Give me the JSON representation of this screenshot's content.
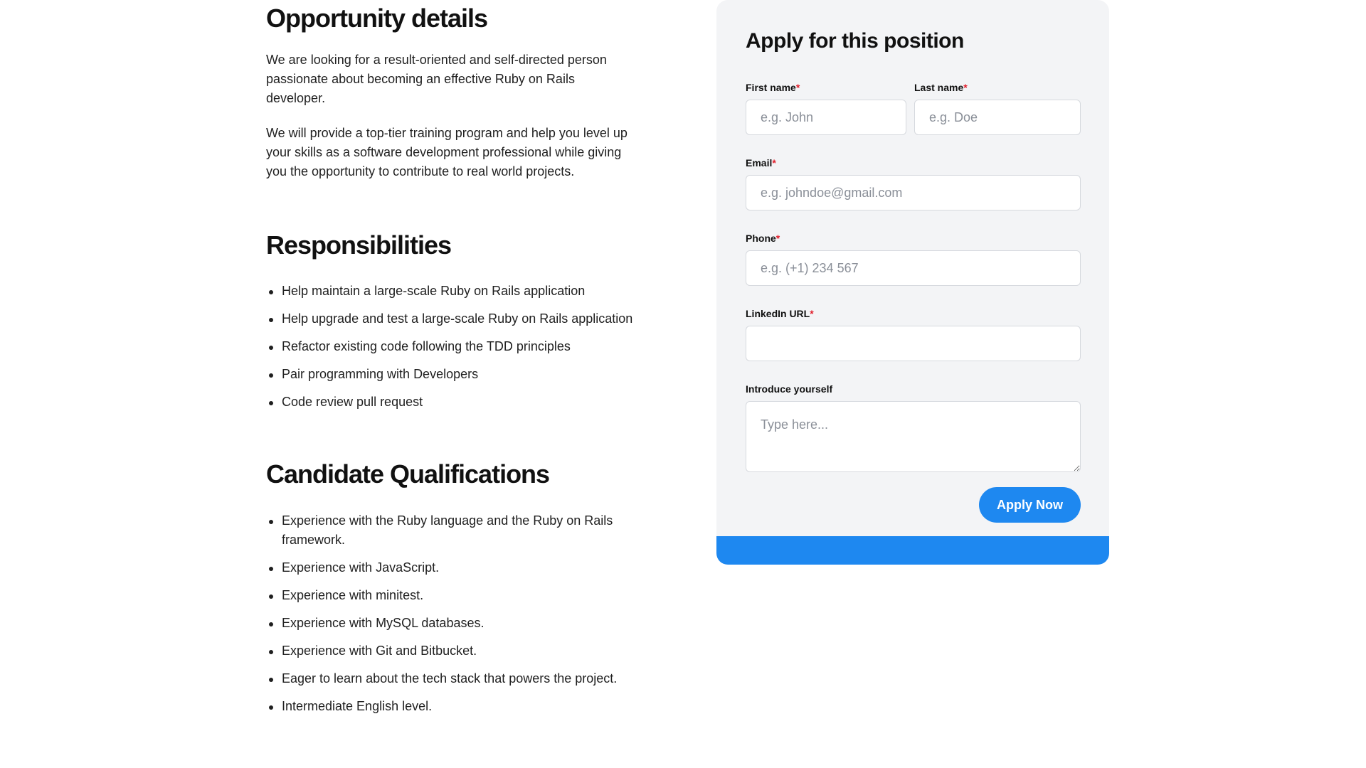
{
  "opportunity": {
    "title": "Opportunity details",
    "paragraphs": [
      "We are looking for a result-oriented and self-directed person passionate about becoming an effective Ruby on Rails developer.",
      "We will provide a top-tier training program and help you level up your skills as a software development professional while giving you the opportunity to contribute to real world projects."
    ]
  },
  "responsibilities": {
    "title": "Responsibilities",
    "items": [
      "Help maintain a large-scale Ruby on Rails application",
      "Help upgrade and test a large-scale Ruby on Rails application",
      "Refactor existing code following the TDD principles",
      "Pair programming with Developers",
      "Code review pull request"
    ]
  },
  "qualifications": {
    "title": "Candidate Qualifications",
    "items": [
      "Experience with the Ruby language and the Ruby on Rails framework.",
      "Experience with JavaScript.",
      "Experience with minitest.",
      "Experience with MySQL databases.",
      "Experience with Git and Bitbucket.",
      "Eager to learn about the tech stack that powers the project.",
      "Intermediate English level."
    ]
  },
  "form": {
    "title": "Apply for this position",
    "required_mark": "*",
    "first_name": {
      "label": "First name",
      "placeholder": "e.g. John",
      "value": ""
    },
    "last_name": {
      "label": "Last name",
      "placeholder": "e.g. Doe",
      "value": ""
    },
    "email": {
      "label": "Email",
      "placeholder": "e.g. johndoe@gmail.com",
      "value": ""
    },
    "phone": {
      "label": "Phone",
      "placeholder": "e.g. (+1) 234 567",
      "value": ""
    },
    "linkedin": {
      "label": "LinkedIn URL",
      "placeholder": "",
      "value": ""
    },
    "introduce": {
      "label": "Introduce yourself",
      "placeholder": "Type here...",
      "value": ""
    },
    "submit_label": "Apply Now"
  },
  "colors": {
    "accent": "#1e88f0",
    "required": "#e11d2a",
    "card_bg": "#f3f4f6"
  }
}
